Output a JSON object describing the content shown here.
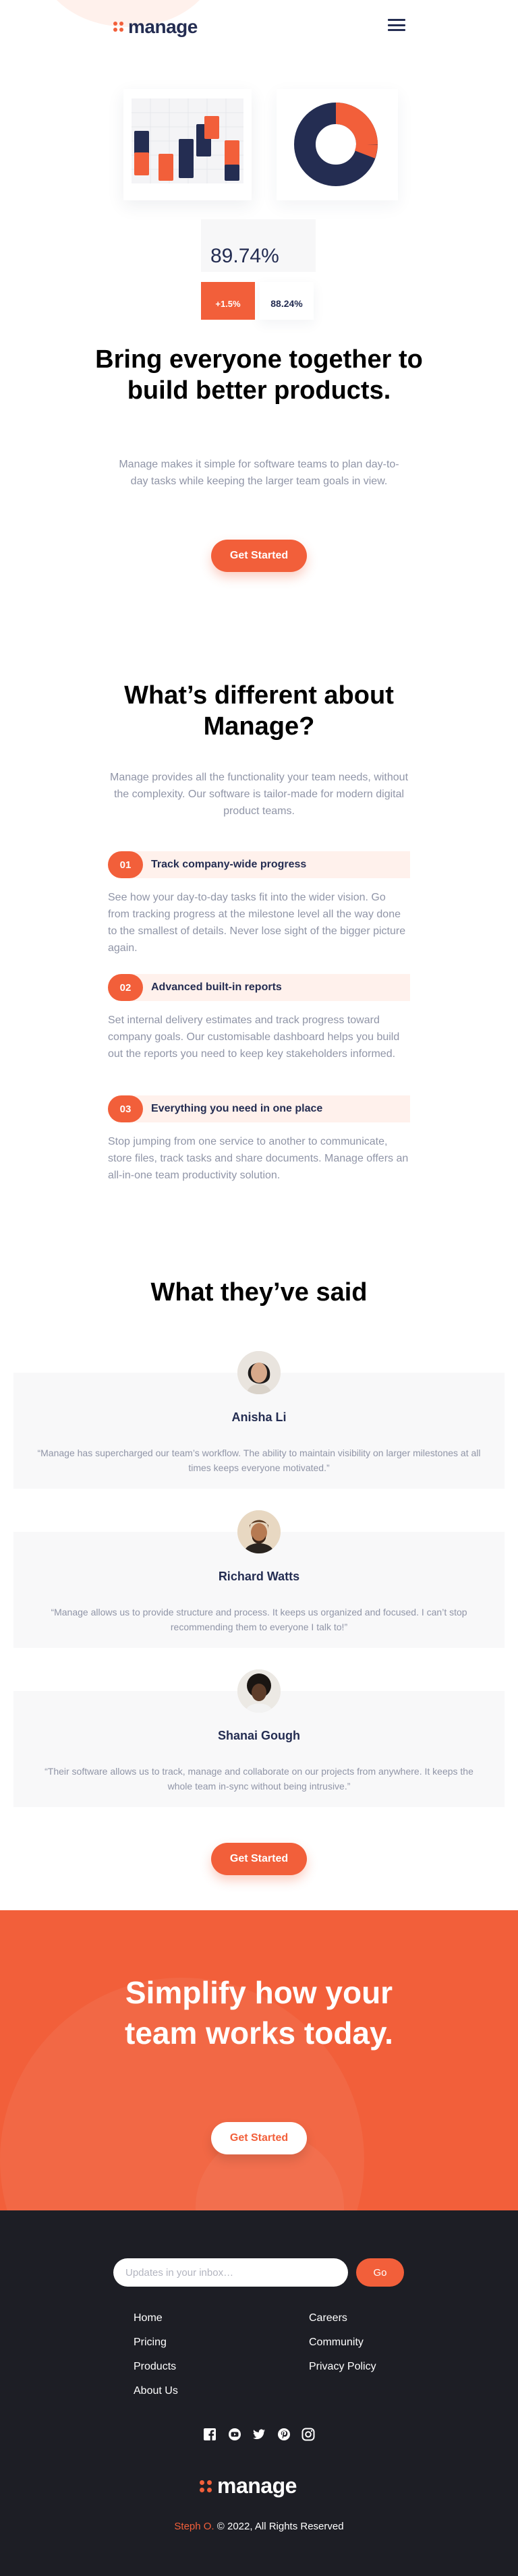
{
  "brand": {
    "name": "manage",
    "accent": "#f25f3a",
    "dark": "#242d52",
    "footer_bg": "#1d1e25"
  },
  "header": {
    "menu_icon": "hamburger-icon"
  },
  "hero": {
    "stat_value": "89.74%",
    "badge_up": "+1.5%",
    "badge_value": "88.24%",
    "title": "Bring everyone together to build better products.",
    "description": "Manage makes it simple for software teams to plan day-to-day tasks while keeping the larger team goals in view.",
    "cta_label": "Get Started"
  },
  "features": {
    "title": "What’s different about Manage?",
    "description": "Manage provides all the functionality your team needs, without the complexity. Our software is tailor-made for modern digital product teams.",
    "items": [
      {
        "number": "01",
        "name": "Track company-wide progress",
        "description": "See how your day-to-day tasks fit into the wider vision. Go from tracking progress at the milestone level all the way done to the smallest of details. Never lose sight of the bigger picture again."
      },
      {
        "number": "02",
        "name": "Advanced built-in reports",
        "description": "Set internal delivery estimates and track progress toward company goals. Our customisable dashboard helps you build out the reports you need to keep key stakeholders informed."
      },
      {
        "number": "03",
        "name": "Everything you need in one place",
        "description": "Stop jumping from one service to another to communicate, store files, track tasks and share documents. Manage offers an all-in-one team productivity solution."
      }
    ]
  },
  "testimonials": {
    "title": "What they’ve said",
    "items": [
      {
        "name": "Anisha Li",
        "quote": "“Manage has supercharged our team’s workflow. The ability to maintain visibility on larger milestones at all times keeps everyone motivated.”"
      },
      {
        "name": "Richard Watts",
        "quote": "“Manage allows us to provide structure and process. It keeps us organized and focused. I can’t stop recommending them to everyone I talk to!”"
      },
      {
        "name": "Shanai Gough",
        "quote": "“Their software allows us to track, manage and collaborate on our projects from anywhere. It keeps the whole team in-sync without being intrusive.”"
      }
    ],
    "cta_label": "Get Started"
  },
  "cta": {
    "title": "Simplify how your team works today.",
    "button_label": "Get Started"
  },
  "footer": {
    "newsletter_placeholder": "Updates in your inbox…",
    "go_label": "Go",
    "links_left": [
      "Home",
      "Pricing",
      "Products",
      "About Us"
    ],
    "links_right": [
      "Careers",
      "Community",
      "Privacy Policy"
    ],
    "socials": [
      "facebook-icon",
      "youtube-icon",
      "twitter-icon",
      "pinterest-icon",
      "instagram-icon"
    ],
    "copyright_author": "Steph O.",
    "copyright_text": "© 2022, All Rights Reserved"
  }
}
